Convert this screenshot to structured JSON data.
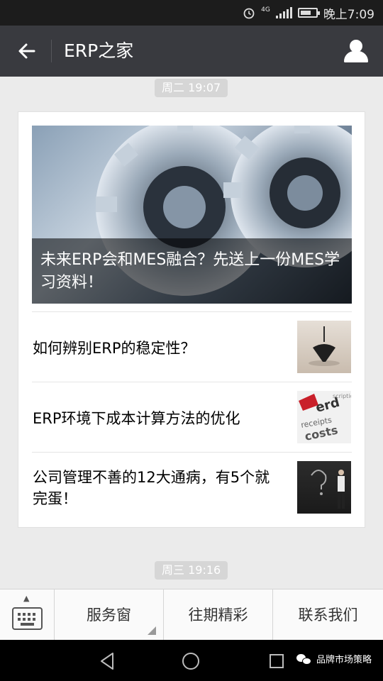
{
  "status_bar": {
    "network": "4G",
    "time": "晚上7:09"
  },
  "header": {
    "title": "ERP之家"
  },
  "timestamps": [
    "周二 19:07",
    "周三 19:16"
  ],
  "article_card": {
    "headline": "未来ERP会和MES融合？先送上一份MES学习资料！",
    "items": [
      {
        "title": "如何辨别ERP的稳定性？"
      },
      {
        "title": "ERP环境下成本计算方法的优化"
      },
      {
        "title": "公司管理不善的12大通病，有5个就完蛋！"
      }
    ]
  },
  "bottom_menu": {
    "items": [
      "服务窗",
      "往期精彩",
      "联系我们"
    ]
  },
  "watermark": "品牌市场策略",
  "icons": {
    "back": "arrow-left-icon",
    "profile": "user-icon",
    "keyboard": "keyboard-icon",
    "alarm": "alarm-icon",
    "signal": "signal-icon",
    "battery": "battery-icon"
  }
}
